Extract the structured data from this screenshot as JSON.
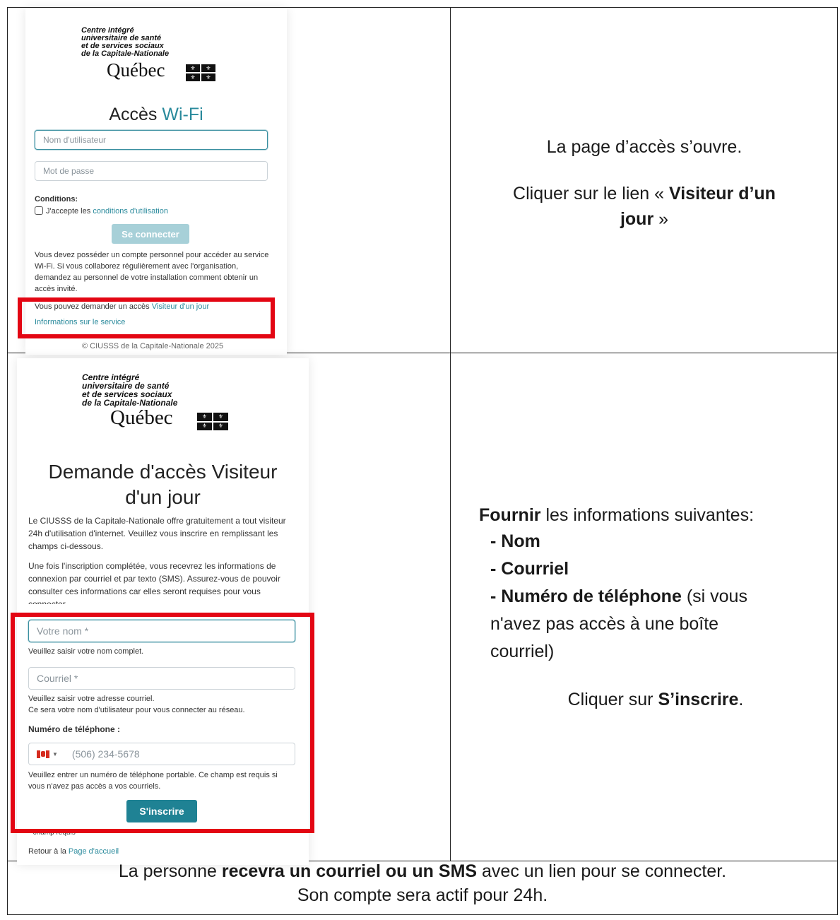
{
  "panel1": {
    "org_lines": [
      "Centre intégré",
      "universitaire de santé",
      "et de services sociaux",
      "de la Capitale-Nationale"
    ],
    "quebec": "Québec",
    "title_plain": "Accès",
    "title_accent": "Wi-Fi",
    "username_placeholder": "Nom d'utilisateur",
    "password_placeholder": "Mot de passe",
    "conditions_label": "Conditions:",
    "accept_prefix": "J'accepte les",
    "accept_link": "conditions d'utilisation",
    "connect_button": "Se connecter",
    "info_paragraph": "Vous devez posséder un compte personnel pour accéder au service Wi-Fi. Si vous collaborez régulièrement avec l'organisation, demandez au personnel de votre installation comment obtenir un accès invité.",
    "visitor_prefix": "Vous pouvez demander un accès",
    "visitor_link": "Visiteur d'un jour",
    "service_link": "Informations sur le service",
    "footer": "© CIUSSS de la Capitale-Nationale 2025"
  },
  "instruction1": {
    "line1": "La page d’accès s’ouvre.",
    "line2_prefix": "Cliquer sur le lien «",
    "line2_bold": "Visiteur d’un",
    "line3_bold": "jour",
    "line3_suffix": "»"
  },
  "panel2": {
    "org_lines": [
      "Centre intégré",
      "universitaire de santé",
      "et de services sociaux",
      "de la Capitale-Nationale"
    ],
    "quebec": "Québec",
    "title_line1": "Demande d'accès Visiteur",
    "title_line2": "d'un jour",
    "paragraph1": "Le CIUSSS de la Capitale-Nationale offre gratuitement a tout visiteur 24h d'utilisation d'internet. Veuillez vous inscrire en remplissant les champs ci-dessous.",
    "paragraph2": "Une fois l'inscription complétée, vous recevrez les informations de connexion par courriel et par texto (SMS). Assurez-vous de pouvoir consulter ces informations car elles seront requises pour vous connecter.",
    "name_placeholder": "Votre nom  *",
    "name_help": "Veuillez saisir votre nom complet.",
    "email_placeholder": "Courriel *",
    "email_help1": "Veuillez saisir votre adresse courriel.",
    "email_help2": "Ce sera votre nom d'utilisateur pour vous connecter au réseau.",
    "phone_label": "Numéro de téléphone :",
    "phone_placeholder": "(506) 234-5678",
    "phone_help": "Veuillez entrer un numéro de téléphone portable. Ce champ est requis si vous n'avez pas accès a vos courriels.",
    "submit_button": "S'inscrire",
    "required_note": "* champ requis",
    "back_prefix": "Retour à la",
    "back_link": "Page d'accueil"
  },
  "instruction2": {
    "provide_bold": "Fournir",
    "provide_rest": "les informations suivantes:",
    "item_name": "- Nom",
    "item_email": "- Courriel",
    "item_phone_bold": "- Numéro de téléphone",
    "item_phone_rest1": "(si vous",
    "item_phone_rest2": "n'avez pas accès à une boîte",
    "item_phone_rest3": "courriel)",
    "click_prefix": "Cliquer sur",
    "click_bold": "S’inscrire",
    "click_suffix": "."
  },
  "footer_note": {
    "prefix": "La personne",
    "bold": "recevra un courriel ou un SMS",
    "suffix": "avec un lien pour se connecter.",
    "line2": "Son compte sera actif pour 24h."
  },
  "colors": {
    "accent": "#2a8a9c",
    "button": "#1f8294",
    "highlight": "#e30613"
  }
}
